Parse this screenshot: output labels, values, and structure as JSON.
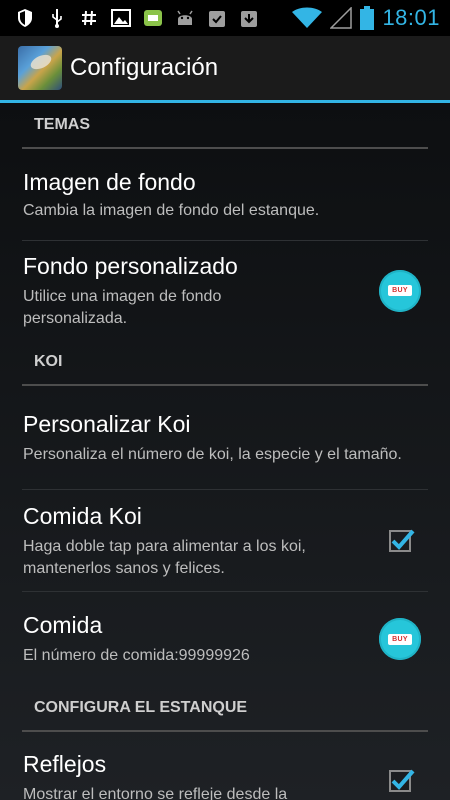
{
  "status_bar": {
    "time": "18:01",
    "left_icons": [
      "shield-icon",
      "usb-icon",
      "hash-icon",
      "image-icon",
      "game-icon",
      "android-icon",
      "clipboard-check-icon",
      "download-icon"
    ],
    "right_icons": [
      "wifi-icon",
      "signal-icon",
      "battery-icon"
    ]
  },
  "action_bar": {
    "title": "Configuración"
  },
  "sections": [
    {
      "header": "TEMAS",
      "items": [
        {
          "title": "Imagen de fondo",
          "summary": "Cambia la imagen de fondo del estanque.",
          "widget": "none"
        },
        {
          "title": "Fondo personalizado",
          "summary": "Utilice una imagen de fondo personalizada.",
          "widget": "buy",
          "buy_label": "BUY"
        }
      ]
    },
    {
      "header": "KOI",
      "items": [
        {
          "title": "Personalizar Koi",
          "summary": "Personaliza el número de koi, la especie y el tamaño.",
          "widget": "none"
        },
        {
          "title": "Comida Koi",
          "summary": "Haga doble tap para alimentar a los koi, mantenerlos sanos y felices.",
          "widget": "checkbox",
          "checked": true
        },
        {
          "title": "Comida",
          "summary": "El número de comida:99999926",
          "widget": "buy",
          "buy_label": "BUY"
        }
      ]
    },
    {
      "header": "CONFIGURA EL ESTANQUE",
      "items": [
        {
          "title": "Reflejos",
          "summary": "Mostrar el entorno se refleje desde la",
          "widget": "checkbox",
          "checked": true
        }
      ]
    }
  ],
  "colors": {
    "accent": "#33b5e5",
    "buy_button": "#26c6da",
    "buy_text": "#d32f2f",
    "checkmark": "#33b5e5"
  }
}
